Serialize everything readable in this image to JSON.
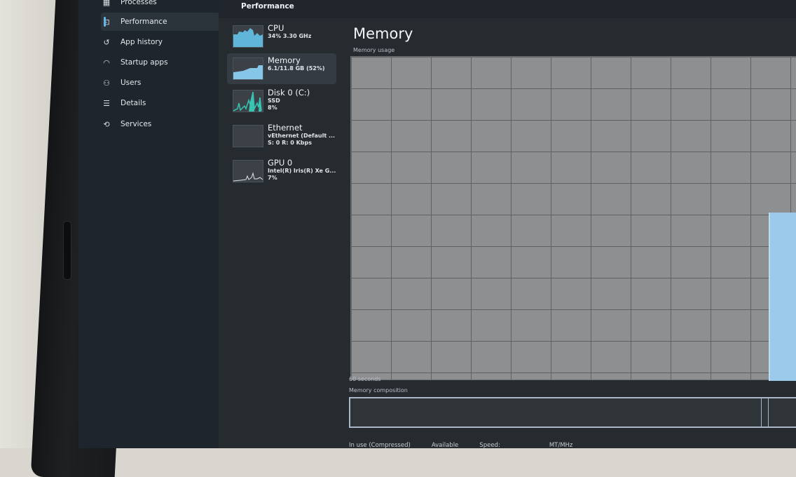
{
  "nav": {
    "items": [
      {
        "label": "Processes",
        "icon": "grid-icon"
      },
      {
        "label": "Performance",
        "icon": "performance-icon",
        "active": true
      },
      {
        "label": "App history",
        "icon": "history-icon"
      },
      {
        "label": "Startup apps",
        "icon": "startup-icon"
      },
      {
        "label": "Users",
        "icon": "users-icon"
      },
      {
        "label": "Details",
        "icon": "list-icon"
      },
      {
        "label": "Services",
        "icon": "services-icon"
      }
    ]
  },
  "header": {
    "title": "Performance"
  },
  "devices": [
    {
      "name": "CPU",
      "line1": "34% 3.30 GHz",
      "line2": ""
    },
    {
      "name": "Memory",
      "line1": "6.1/11.8 GB (52%)",
      "line2": ""
    },
    {
      "name": "Disk 0 (C:)",
      "line1": "SSD",
      "line2": "8%"
    },
    {
      "name": "Ethernet",
      "line1": "vEthernet (Default ...",
      "line2": "S: 0 R: 0 Kbps"
    },
    {
      "name": "GPU 0",
      "line1": "Intel(R) Iris(R) Xe G...",
      "line2": "7%"
    }
  ],
  "detail": {
    "title": "Memory",
    "usage_label": "Memory usage",
    "time_label": "60 seconds",
    "composition_label": "Memory composition",
    "bottom_labels": [
      "In use (Compressed)",
      "Available",
      "Speed:",
      "MT/MHz"
    ]
  },
  "colors": {
    "accent": "#60b8e8",
    "graph_fill": "#9ccaea",
    "graph_bg": "#8e8f91"
  }
}
